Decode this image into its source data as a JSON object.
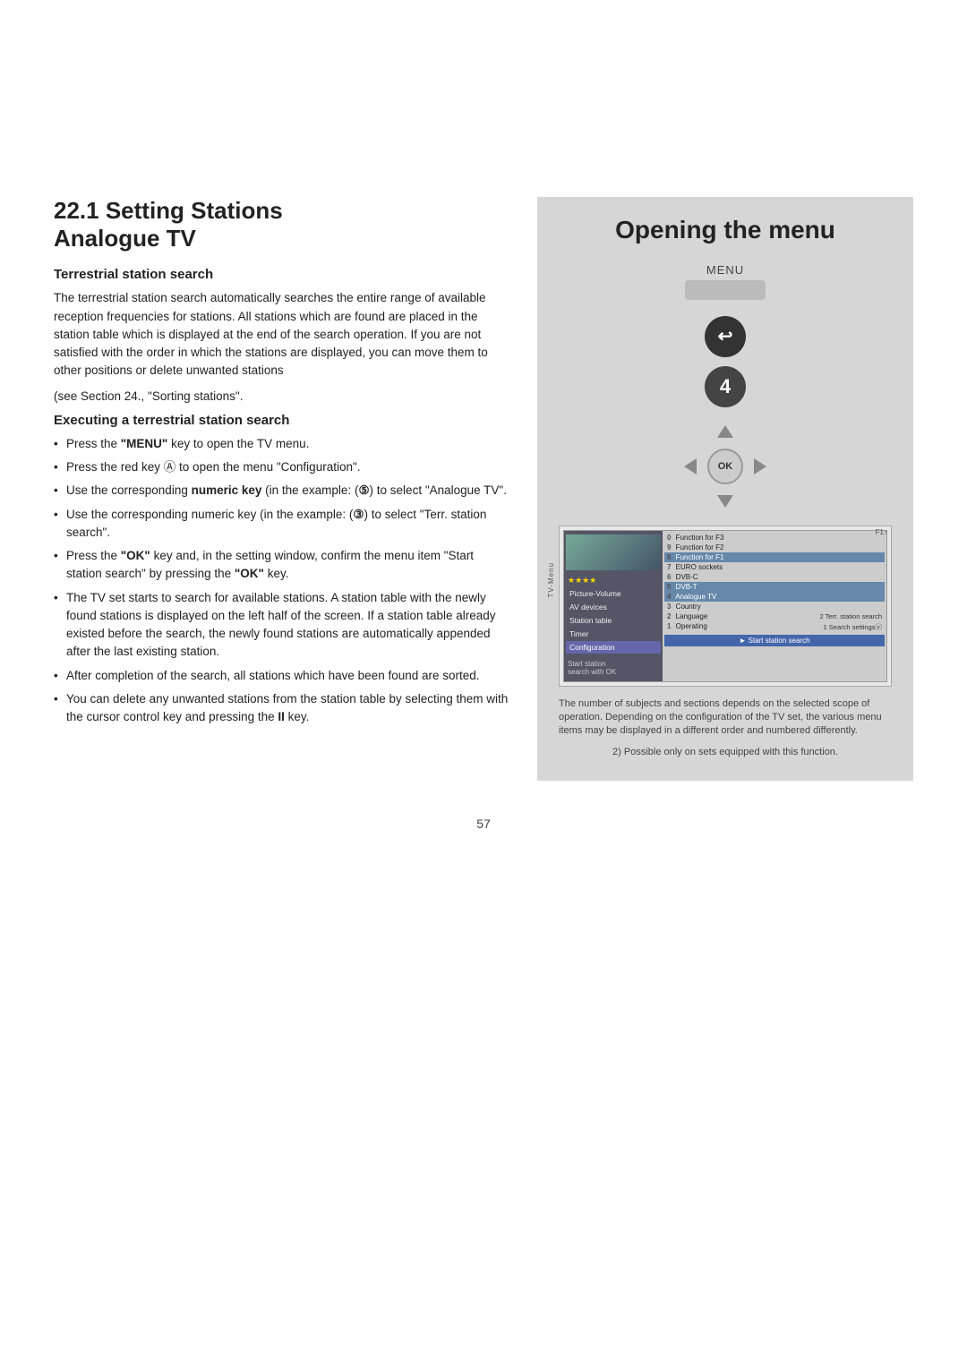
{
  "page": {
    "number": "57",
    "top_spacer_visible": true
  },
  "left_column": {
    "section_title_line1": "22.1 Setting Stations",
    "section_title_line2": "Analogue TV",
    "terrestrial_title": "Terrestrial station search",
    "terrestrial_body": "The terrestrial station search automatically searches the entire range of available reception frequencies for stations. All stations which are found are placed in the station table which is displayed at the end of the search operation. If you are not satisfied with the order in which the stations are displayed, you can move them to other positions or delete unwanted stations",
    "terrestrial_body2": "(see Section 24., \"Sorting stations\".",
    "executing_title": "Executing a terrestrial station search",
    "bullets": [
      "Press the \"MENU\" key to open the TV menu.",
      "Press the red key Ⓢ to open the menu \"Configuration\".",
      "Use the corresponding numeric key (in the example: (⑤) to select \"Analogue TV\".",
      "Use the corresponding numeric key (in the example: (③) to select \"Terr. station search\".",
      "Press the \"OK\" key and, in the setting window, confirm the menu item \"Start station search\" by pressing the \"OK\" key.",
      "The TV set starts to search for available stations. A station table with the newly found stations is displayed on the left half of the screen. If a station table already existed before the search, the newly found stations are automatically appended after the last existing station.",
      "After completion of the search, all stations which have been found are sorted.",
      "You can delete any unwanted stations from the station table by selecting them with the cursor control key and pressing the II key."
    ]
  },
  "right_column": {
    "opening_menu_title": "Opening the menu",
    "menu_label": "MENU",
    "remote_steps": [
      {
        "icon": "back-arrow",
        "symbol": "↩"
      },
      {
        "icon": "number-4",
        "symbol": "4"
      }
    ],
    "dpad_label": "OK",
    "tv_menu": {
      "thumbnail_alt": "TV screen thumbnail",
      "stars": "★★★★",
      "left_items": [
        {
          "label": "Picture-Volume",
          "active": false
        },
        {
          "label": "AV devices",
          "active": false
        },
        {
          "label": "Station table",
          "active": false
        },
        {
          "label": "Timer",
          "active": false
        },
        {
          "label": "Configuration",
          "active": true
        }
      ],
      "fi_label": "F1↑",
      "right_rows": [
        {
          "num": "0",
          "label": "Function for F3"
        },
        {
          "num": "9",
          "label": "Function for F2"
        },
        {
          "num": "8",
          "label": "Function for F1",
          "highlighted": true
        },
        {
          "num": "7",
          "label": "EURO sockets"
        },
        {
          "num": "6",
          "label": "DVB-C"
        },
        {
          "num": "5",
          "label": "DVB-T",
          "highlighted": true
        },
        {
          "num": "4",
          "label": "Analogue TV",
          "highlighted": true
        },
        {
          "num": "3",
          "label": "Country"
        },
        {
          "num": "2",
          "label": "Language",
          "right": "2  Terr. station search",
          "highlighted": true
        },
        {
          "num": "1",
          "label": "Operating",
          "right": "1  Search settingsⓔ",
          "highlighted": false
        }
      ],
      "start_label": "Start station",
      "start_label2": "search with OK",
      "start_bar": "► Start station search"
    },
    "footer_note": "The number of subjects and sections depends on the selected scope of operation. Depending on the configuration of the TV set, the various menu items may be displayed in a different order and numbered differently.",
    "footnote": "2) Possible only on sets equipped with this function."
  }
}
